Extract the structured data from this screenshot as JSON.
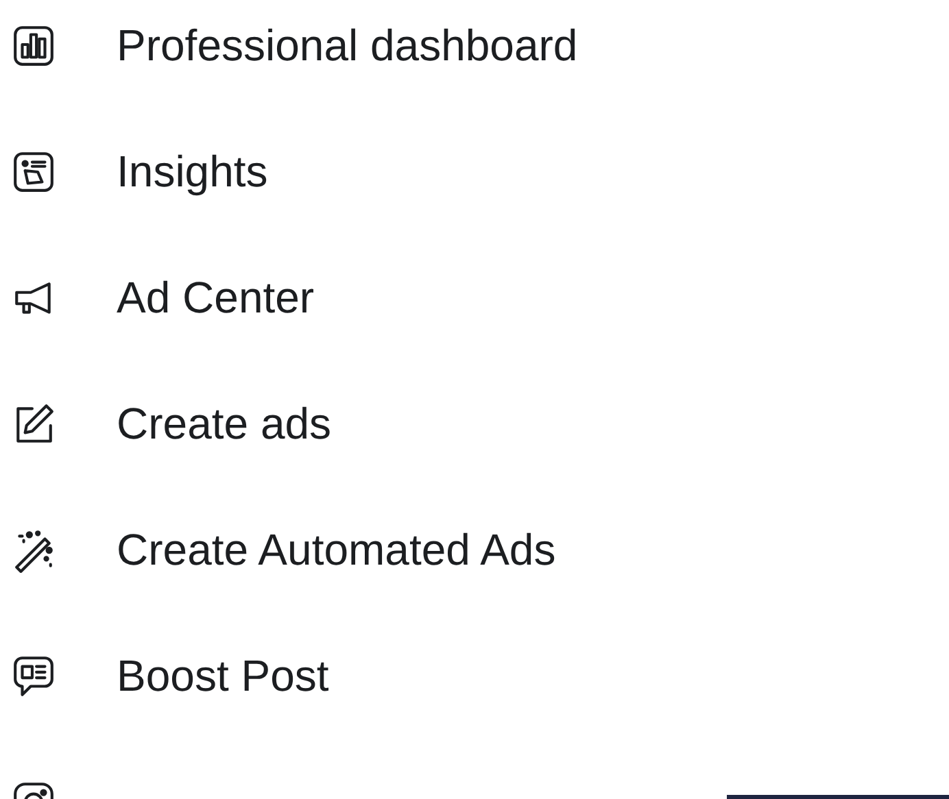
{
  "menu": {
    "items": [
      {
        "label": "Professional dashboard"
      },
      {
        "label": "Insights"
      },
      {
        "label": "Ad Center"
      },
      {
        "label": "Create ads"
      },
      {
        "label": "Create Automated Ads"
      },
      {
        "label": "Boost Post"
      }
    ]
  }
}
